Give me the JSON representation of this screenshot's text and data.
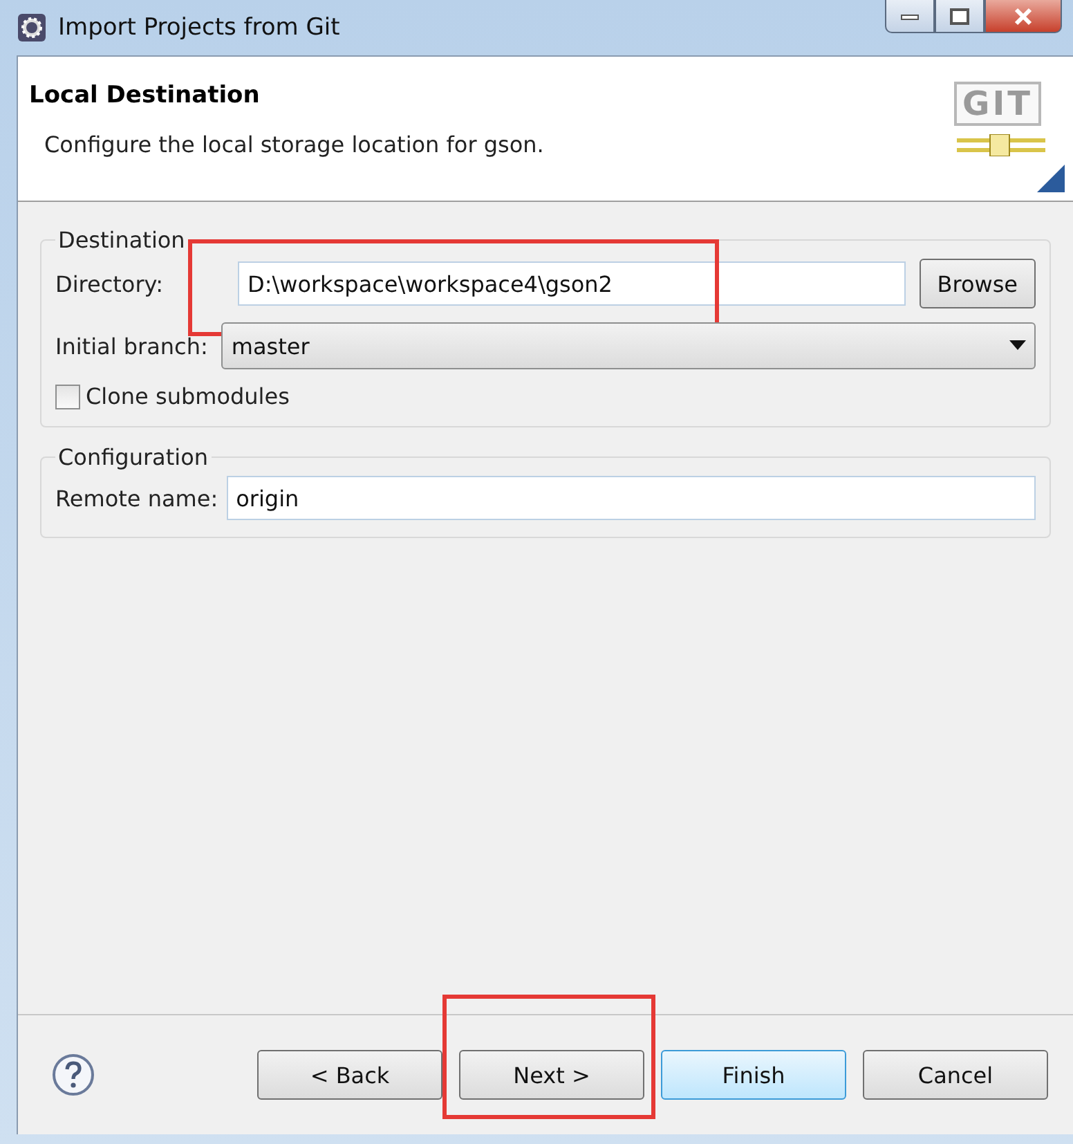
{
  "window": {
    "title": "Import Projects from Git"
  },
  "header": {
    "title": "Local Destination",
    "description": "Configure the local storage location for gson.",
    "logo": "GIT"
  },
  "destination": {
    "legend": "Destination",
    "directory": {
      "label": "Directory:",
      "value": "D:\\workspace\\workspace4\\gson2",
      "highlighted": true
    },
    "browse": {
      "label": "Browse"
    },
    "initial_branch": {
      "label": "Initial branch:",
      "value": "master"
    },
    "clone_submodules": {
      "label": "Clone submodules",
      "checked": false
    }
  },
  "configuration": {
    "legend": "Configuration",
    "remote_name": {
      "label": "Remote name:",
      "value": "origin"
    }
  },
  "buttons": [
    {
      "label": "< Back",
      "default": false,
      "highlighted": false
    },
    {
      "label": "Next >",
      "default": false,
      "highlighted": true
    },
    {
      "label": "Finish",
      "default": true,
      "highlighted": false
    },
    {
      "label": "Cancel",
      "default": false,
      "highlighted": false
    }
  ]
}
